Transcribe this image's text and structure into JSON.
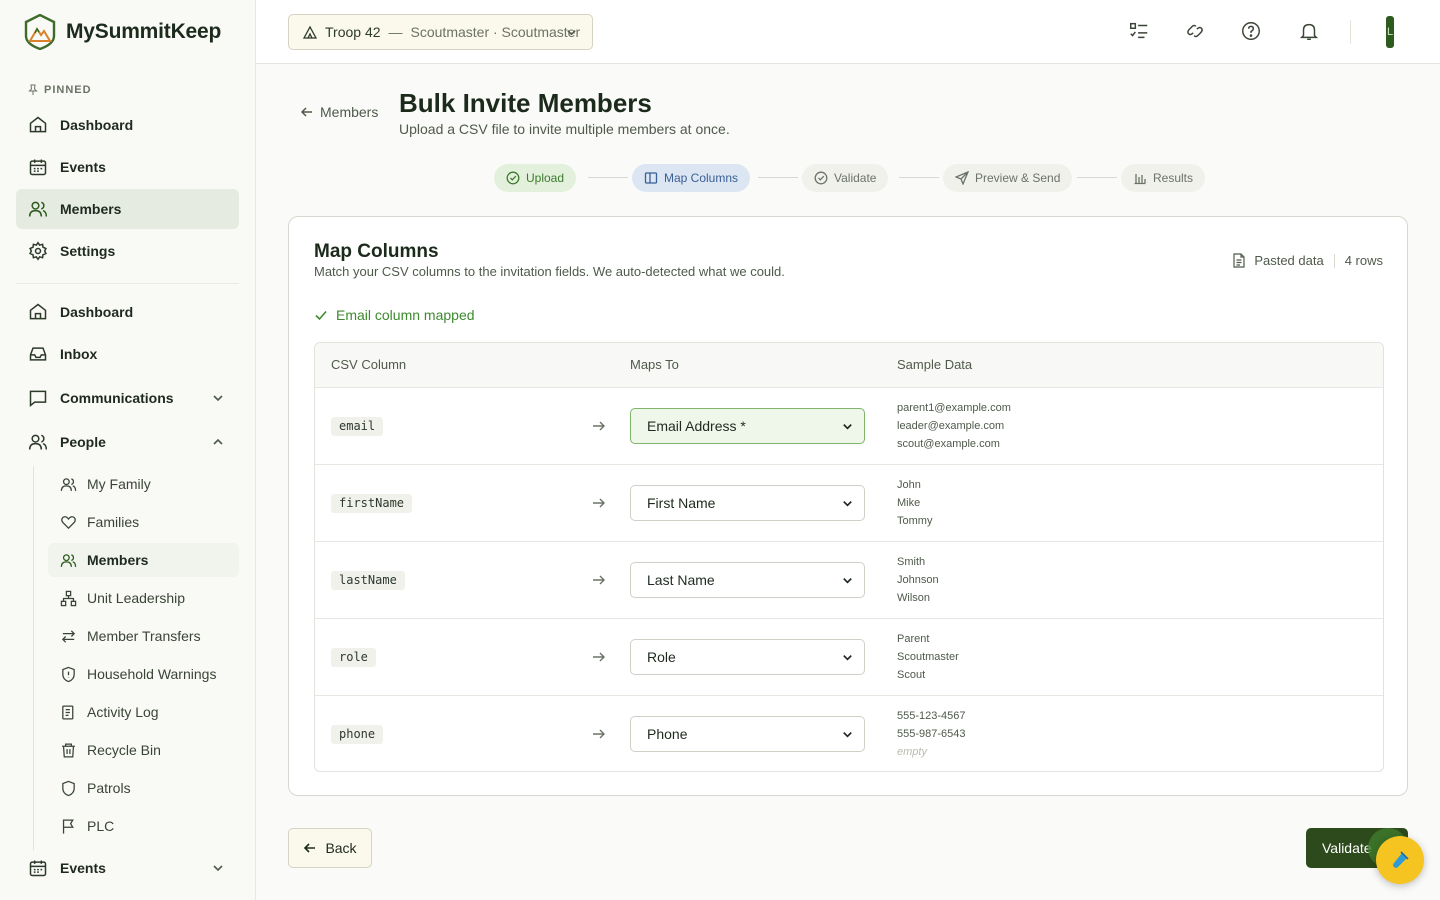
{
  "app": {
    "name": "MySummitKeep"
  },
  "sidebar": {
    "pinned_label": "PINNED",
    "pinned": [
      {
        "label": "Dashboard",
        "icon": "home-icon"
      },
      {
        "label": "Events",
        "icon": "calendar-icon"
      },
      {
        "label": "Members",
        "icon": "users-icon",
        "active": true
      },
      {
        "label": "Settings",
        "icon": "gear-icon"
      }
    ],
    "main": [
      {
        "label": "Dashboard",
        "icon": "home-icon"
      },
      {
        "label": "Inbox",
        "icon": "inbox-icon"
      },
      {
        "label": "Communications",
        "icon": "message-square-icon",
        "expandable": true,
        "expanded": false
      },
      {
        "label": "People",
        "icon": "users-icon",
        "expandable": true,
        "expanded": true
      }
    ],
    "people_children": [
      {
        "label": "My Family",
        "icon": "users-icon"
      },
      {
        "label": "Families",
        "icon": "heart-icon"
      },
      {
        "label": "Members",
        "icon": "users-icon",
        "active": true
      },
      {
        "label": "Unit Leadership",
        "icon": "org-chart-icon"
      },
      {
        "label": "Member Transfers",
        "icon": "transfer-icon"
      },
      {
        "label": "Household Warnings",
        "icon": "shield-alert-icon"
      },
      {
        "label": "Activity Log",
        "icon": "log-icon"
      },
      {
        "label": "Recycle Bin",
        "icon": "trash-icon"
      },
      {
        "label": "Patrols",
        "icon": "shield-icon"
      },
      {
        "label": "PLC",
        "icon": "flag-icon"
      }
    ],
    "events_section": {
      "label": "Events",
      "icon": "calendar-icon"
    }
  },
  "topbar": {
    "troop": "Troop 42",
    "troop_sep": "—",
    "troop_role": "Scoutmaster · Scoutmaster",
    "avatar_initial": "L"
  },
  "header": {
    "back_label": "Members",
    "title": "Bulk Invite Members",
    "subtitle": "Upload a CSV file to invite multiple members at once."
  },
  "steps": [
    {
      "label": "Upload",
      "state": "done",
      "icon": "check-circle-icon"
    },
    {
      "label": "Map Columns",
      "state": "current",
      "icon": "columns-icon"
    },
    {
      "label": "Validate",
      "state": "pending",
      "icon": "check-circle-icon"
    },
    {
      "label": "Preview & Send",
      "state": "pending",
      "icon": "send-icon"
    },
    {
      "label": "Results",
      "state": "pending",
      "icon": "bar-chart-icon"
    }
  ],
  "card": {
    "title": "Map Columns",
    "subtitle": "Match your CSV columns to the invitation fields. We auto-detected what we could.",
    "source_label": "Pasted data",
    "row_count": "4 rows",
    "status": "Email column mapped"
  },
  "table": {
    "headers": [
      "CSV Column",
      "Maps To",
      "Sample Data"
    ],
    "rows": [
      {
        "column": "email",
        "maps_to": "Email Address *",
        "ok": true,
        "samples": [
          "parent1@example.com",
          "leader@example.com",
          "scout@example.com"
        ]
      },
      {
        "column": "firstName",
        "maps_to": "First Name",
        "samples": [
          "John",
          "Mike",
          "Tommy"
        ]
      },
      {
        "column": "lastName",
        "maps_to": "Last Name",
        "samples": [
          "Smith",
          "Johnson",
          "Wilson"
        ]
      },
      {
        "column": "role",
        "maps_to": "Role",
        "samples": [
          "Parent",
          "Scoutmaster",
          "Scout"
        ]
      },
      {
        "column": "phone",
        "maps_to": "Phone",
        "samples": [
          "555-123-4567",
          "555-987-6543"
        ],
        "empty_label": "empty"
      }
    ]
  },
  "footer": {
    "back_label": "Back",
    "validate_label": "Validate"
  },
  "colors": {
    "brand_green": "#2d4a1c",
    "success": "#3e8a2f",
    "current_step": "#3a5f94",
    "fab": "#f6c420"
  }
}
